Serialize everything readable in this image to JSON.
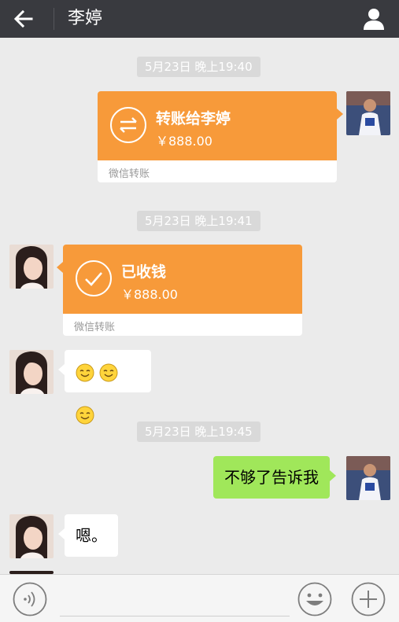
{
  "header": {
    "title": "李婷",
    "back_icon": "arrow-left-icon",
    "profile_icon": "user-icon"
  },
  "messages": [
    {
      "type": "timestamp",
      "text": "5月23日 晚上19:40"
    },
    {
      "type": "transfer",
      "side": "right",
      "title": "转账给李婷",
      "amount": "￥888.00",
      "footer": "微信转账",
      "icon": "transfer-arrows-icon"
    },
    {
      "type": "timestamp",
      "text": "5月23日 晚上19:41"
    },
    {
      "type": "transfer",
      "side": "left",
      "title": "已收钱",
      "amount": "￥888.00",
      "footer": "微信转账",
      "icon": "check-icon"
    },
    {
      "type": "emoji",
      "side": "left",
      "count": 3,
      "icon": "smile-emoji-icon"
    },
    {
      "type": "timestamp",
      "text": "5月23日 晚上19:45"
    },
    {
      "type": "text",
      "side": "right",
      "text": "不够了告诉我"
    },
    {
      "type": "text",
      "side": "left",
      "text": "嗯。"
    }
  ],
  "input_bar": {
    "voice_icon": "voice-icon",
    "emoji_icon": "emoji-icon",
    "plus_icon": "plus-icon",
    "text_value": ""
  },
  "colors": {
    "header_bg": "#393a3f",
    "chat_bg": "#ebebeb",
    "transfer_orange": "#f79a3a",
    "sent_green": "#a0e75a",
    "timestamp_bg": "#d9d9d9"
  }
}
